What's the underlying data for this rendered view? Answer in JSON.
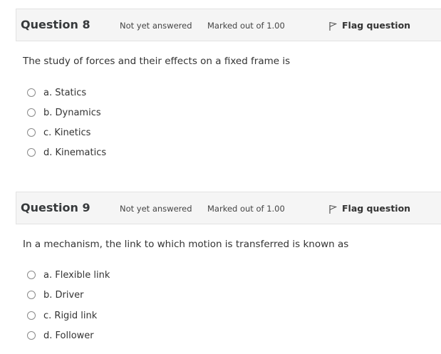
{
  "questions": [
    {
      "title": "Question 8",
      "state": "Not yet answered",
      "mark": "Marked out of 1.00",
      "flag_label": "Flag question",
      "text": "The study of forces and their effects on a fixed frame is",
      "answers": [
        "a. Statics",
        "b. Dynamics",
        "c. Kinetics",
        "d. Kinematics"
      ]
    },
    {
      "title": "Question 9",
      "state": "Not yet answered",
      "mark": "Marked out of 1.00",
      "flag_label": "Flag question",
      "text": "In a mechanism, the link to which motion is transferred is known as",
      "answers": [
        "a. Flexible link",
        "b. Driver",
        "c. Rigid link",
        "d. Follower"
      ]
    }
  ]
}
